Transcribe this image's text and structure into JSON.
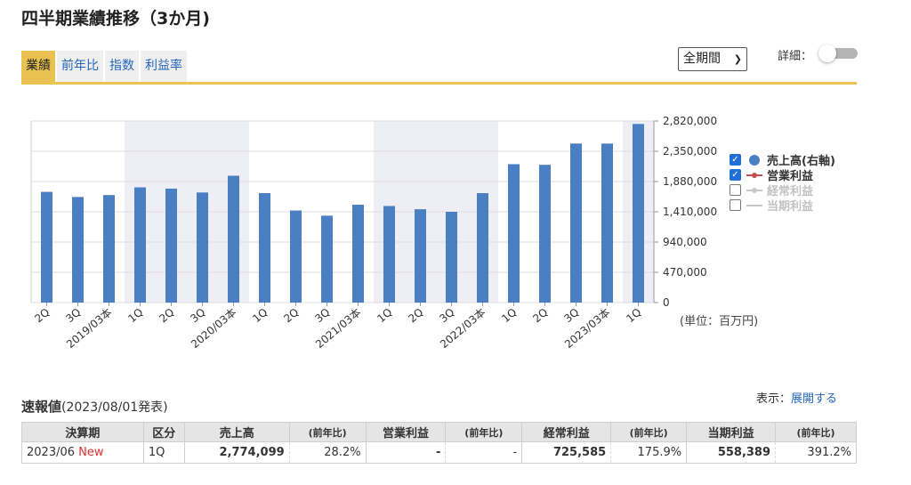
{
  "page": {
    "title": "四半期業績推移（3か月)"
  },
  "tabs": [
    {
      "label": "業績",
      "active": true
    },
    {
      "label": "前年比",
      "active": false
    },
    {
      "label": "指数",
      "active": false
    },
    {
      "label": "利益率",
      "active": false
    }
  ],
  "period_select": {
    "value": "全期間"
  },
  "detail_toggle": {
    "label": "詳細：",
    "on": false
  },
  "chart_data": {
    "type": "bar",
    "categories": [
      "2Q",
      "3Q",
      "2019/03本",
      "1Q",
      "2Q",
      "3Q",
      "2020/03本",
      "1Q",
      "2Q",
      "3Q",
      "2021/03本",
      "1Q",
      "2Q",
      "3Q",
      "2022/03本",
      "1Q",
      "2Q",
      "3Q",
      "2023/03本",
      "1Q"
    ],
    "series": [
      {
        "name": "売上高(右軸)",
        "color": "#4b7fc4",
        "values": [
          1720000,
          1640000,
          1670000,
          1790000,
          1770000,
          1710000,
          1970000,
          1700000,
          1430000,
          1350000,
          1520000,
          1500000,
          1450000,
          1410000,
          1700000,
          2150000,
          2140000,
          2470000,
          2470000,
          2774099
        ]
      }
    ],
    "y_ticks": [
      "2,820,000",
      "2,350,000",
      "1,880,000",
      "1,410,000",
      "940,000",
      "470,000",
      "0"
    ],
    "ylim": [
      0,
      2820000
    ],
    "fiscal_year_shading": [
      "#ffffff",
      "#eeeef7",
      "#ffffff",
      "#eeeef7",
      "#ffffff",
      "#eeeef7"
    ],
    "unit_label": "(単位：百万円)",
    "legend": [
      {
        "label": "売上高(右軸)",
        "checked": true,
        "symbol": "dot",
        "color": "#4b7fc4"
      },
      {
        "label": "営業利益",
        "checked": true,
        "symbol": "line",
        "color": "#c0504d"
      },
      {
        "label": "経常利益",
        "checked": false,
        "symbol": "line",
        "color": "#c8c8c8"
      },
      {
        "label": "当期利益",
        "checked": false,
        "symbol": "line",
        "color": "#c8c8c8"
      }
    ]
  },
  "quick_report": {
    "title": "速報値",
    "date": "(2023/08/01発表)",
    "display_label": "表示：",
    "expand_link": "展開する",
    "headers": [
      "決算期",
      "区分",
      "売上高",
      "(前年比)",
      "営業利益",
      "(前年比)",
      "経常利益",
      "(前年比)",
      "当期利益",
      "(前年比)"
    ],
    "row": {
      "period": "2023/06",
      "new_badge": "New",
      "kubun": "1Q",
      "sales": "2,774,099",
      "sales_yoy": "28.2%",
      "op_profit": "-",
      "op_yoy": "-",
      "ord_profit": "725,585",
      "ord_yoy": "175.9%",
      "net_profit": "558,389",
      "net_yoy": "391.2%"
    }
  }
}
